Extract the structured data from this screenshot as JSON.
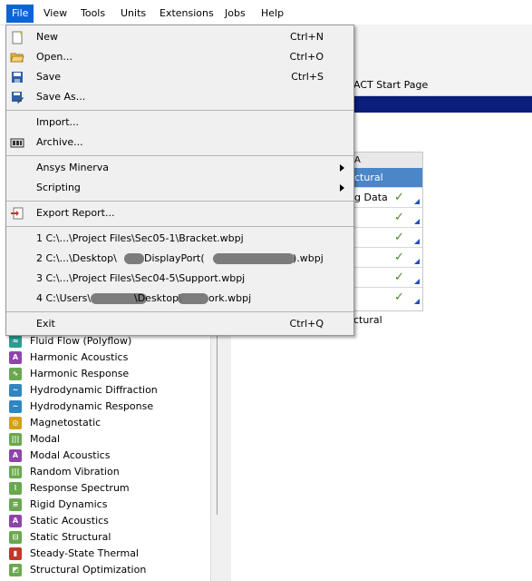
{
  "menubar": {
    "items": [
      {
        "label": "File"
      },
      {
        "label": "View"
      },
      {
        "label": "Tools"
      },
      {
        "label": "Units"
      },
      {
        "label": "Extensions"
      },
      {
        "label": "Jobs"
      },
      {
        "label": "Help"
      }
    ]
  },
  "file_menu": {
    "items": [
      {
        "label": "New",
        "shortcut": "Ctrl+N",
        "icon": "new-file-icon"
      },
      {
        "label": "Open...",
        "shortcut": "Ctrl+O",
        "icon": "open-folder-icon"
      },
      {
        "label": "Save",
        "shortcut": "Ctrl+S",
        "icon": "save-icon"
      },
      {
        "label": "Save As...",
        "shortcut": "",
        "icon": "save-as-icon"
      },
      {
        "label": "Import...",
        "shortcut": "",
        "icon": ""
      },
      {
        "label": "Archive...",
        "shortcut": "",
        "icon": "archive-icon"
      },
      {
        "label": "Ansys Minerva",
        "shortcut": "",
        "submenu": true
      },
      {
        "label": "Scripting",
        "shortcut": "",
        "submenu": true
      },
      {
        "label": "Export Report...",
        "shortcut": "",
        "icon": "export-report-icon"
      },
      {
        "label": "1 C:\\...\\Project Files\\Sec05-1\\Bracket.wbpj"
      },
      {
        "label": "2 C:\\...\\Desktop\\",
        "suffix": ".wbpj",
        "mid": "DisplayPort(",
        "tail": ").wbpj"
      },
      {
        "label": "3 C:\\...\\Project Files\\Sec04-5\\Support.wbpj"
      },
      {
        "label": "4 C:\\Users\\",
        "mid": "\\Desktop\\",
        "tail": "ork.wbpj"
      },
      {
        "label": "Exit",
        "shortcut": "Ctrl+Q"
      }
    ]
  },
  "act_tab": {
    "label": "ACT Start Page"
  },
  "system": {
    "header": "A",
    "title": "ctural",
    "rows": [
      {
        "label": "g Data"
      },
      {
        "label": ""
      },
      {
        "label": ""
      },
      {
        "label": ""
      },
      {
        "label": ""
      },
      {
        "label": ""
      }
    ],
    "caption": "ctural"
  },
  "toolbox": {
    "items": [
      {
        "label": "Fluid Flow (Polyflow)",
        "color": "#2a9d8f"
      },
      {
        "label": "Harmonic Acoustics",
        "color": "#8e44ad"
      },
      {
        "label": "Harmonic Response",
        "color": "#6aa84f"
      },
      {
        "label": "Hydrodynamic Diffraction",
        "color": "#2e86c1"
      },
      {
        "label": "Hydrodynamic Response",
        "color": "#2e86c1"
      },
      {
        "label": "Magnetostatic",
        "color": "#d4a017"
      },
      {
        "label": "Modal",
        "color": "#6aa84f"
      },
      {
        "label": "Modal Acoustics",
        "color": "#8e44ad"
      },
      {
        "label": "Random Vibration",
        "color": "#6aa84f"
      },
      {
        "label": "Response Spectrum",
        "color": "#6aa84f"
      },
      {
        "label": "Rigid Dynamics",
        "color": "#6aa84f"
      },
      {
        "label": "Static Acoustics",
        "color": "#8e44ad"
      },
      {
        "label": "Static Structural",
        "color": "#6aa84f"
      },
      {
        "label": "Steady-State Thermal",
        "color": "#c0392b"
      },
      {
        "label": "Structural Optimization",
        "color": "#6aa84f"
      }
    ]
  }
}
